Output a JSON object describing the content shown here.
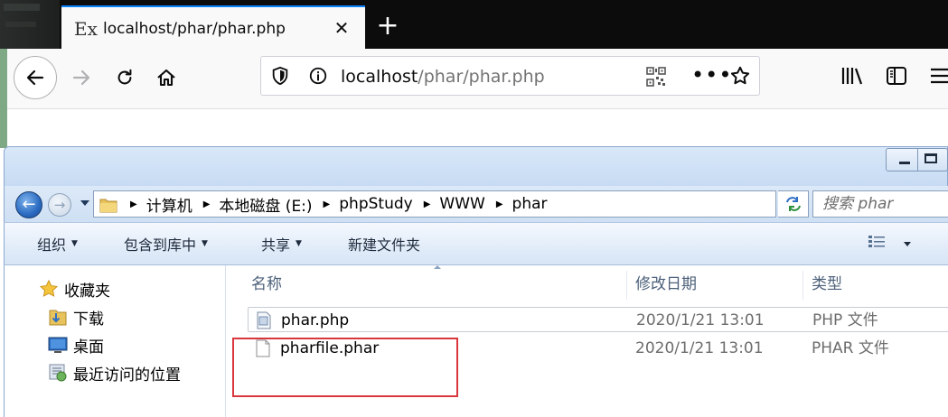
{
  "browser": {
    "tab": {
      "title": "localhost/phar/phar.php",
      "favicon": "Ex",
      "close": "✕"
    },
    "new_tab": "+",
    "url": {
      "host": "localhost",
      "path": "/phar/phar.php"
    },
    "accent": "#0a84ff"
  },
  "explorer": {
    "breadcrumbs": [
      "计算机",
      "本地磁盘 (E:)",
      "phpStudy",
      "WWW",
      "phar"
    ],
    "search_placeholder": "搜索 phar",
    "toolbar": {
      "organize": "组织",
      "include_in_library": "包含到库中",
      "share": "共享",
      "new_folder": "新建文件夹"
    },
    "nav": {
      "favorites": "收藏夹",
      "downloads": "下载",
      "desktop": "桌面",
      "recent": "最近访问的位置"
    },
    "columns": {
      "name": "名称",
      "date": "修改日期",
      "type": "类型"
    },
    "files": [
      {
        "name": "phar.php",
        "date": "2020/1/21 13:01",
        "type": "PHP 文件"
      },
      {
        "name": "pharfile.phar",
        "date": "2020/1/21 13:01",
        "type": "PHAR 文件"
      }
    ],
    "highlight_color": "#d9363e"
  }
}
